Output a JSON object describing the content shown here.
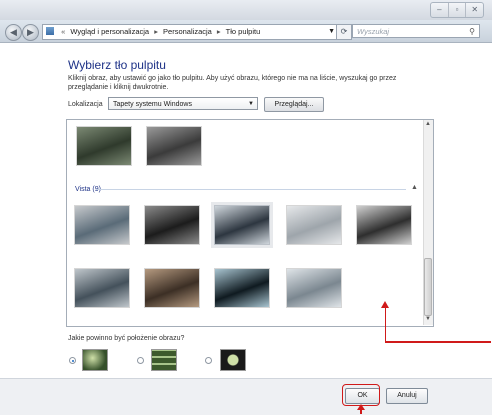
{
  "window": {
    "controls": [
      "–",
      "▫",
      "✕"
    ]
  },
  "nav": {
    "back": "◀",
    "forward": "▶",
    "breadcrumb": {
      "lead": "«",
      "items": [
        "Wygląd i personalizacja",
        "Personalizacja",
        "Tło pulpitu"
      ],
      "separator": "▸"
    },
    "search_placeholder": "Wyszukaj"
  },
  "page": {
    "heading": "Wybierz tło pulpitu",
    "description": "Kliknij obraz, aby ustawić go jako tło pulpitu. Aby użyć obrazu, którego nie ma na liście, wyszukaj go przez przeglądanie i kliknij dwukrotnie.",
    "location_label": "Lokalizacja",
    "location_value": "Tapety systemu Windows",
    "browse_label": "Przeglądaj..."
  },
  "gallery": {
    "group_label": "Vista (9)",
    "scroll_position": 0.75,
    "top_row": [
      {
        "name": "fern-wallpaper",
        "colors": [
          "#2f3a2c",
          "#7c8a74"
        ]
      },
      {
        "name": "trees-wallpaper",
        "colors": [
          "#3b3b3b",
          "#9a9a9a"
        ]
      }
    ],
    "vista_row_1": [
      {
        "name": "mountain-wallpaper",
        "colors": [
          "#5a6b78",
          "#c6c9cc"
        ]
      },
      {
        "name": "dark-hills-wallpaper",
        "colors": [
          "#1c1c1c",
          "#8b8b8b"
        ]
      },
      {
        "name": "lake-wallpaper",
        "colors": [
          "#2d3640",
          "#cfd6dc"
        ],
        "selected": true
      },
      {
        "name": "feather-wallpaper",
        "colors": [
          "#9ea5ab",
          "#e6e8ea"
        ]
      },
      {
        "name": "grass-wallpaper",
        "colors": [
          "#2e2e2e",
          "#d0d0d0"
        ]
      }
    ],
    "vista_row_2": [
      {
        "name": "sea-wallpaper",
        "colors": [
          "#44515b",
          "#bfc6cb"
        ]
      },
      {
        "name": "pebbles-wallpaper",
        "colors": [
          "#3c2f25",
          "#b59a80"
        ]
      },
      {
        "name": "aurora-wallpaper",
        "colors": [
          "#0f1a20",
          "#a8c4d0"
        ]
      },
      {
        "name": "silk-wallpaper",
        "colors": [
          "#7b8790",
          "#dfe4e8"
        ]
      }
    ]
  },
  "position": {
    "label": "Jakie powinno być położenie obrazu?",
    "options": [
      {
        "name": "fill-option",
        "selected": true
      },
      {
        "name": "tile-option",
        "selected": false
      },
      {
        "name": "center-option",
        "selected": false
      }
    ]
  },
  "footer": {
    "ok_label": "OK",
    "cancel_label": "Anuluj"
  },
  "annotation_color": "#d01a1a"
}
